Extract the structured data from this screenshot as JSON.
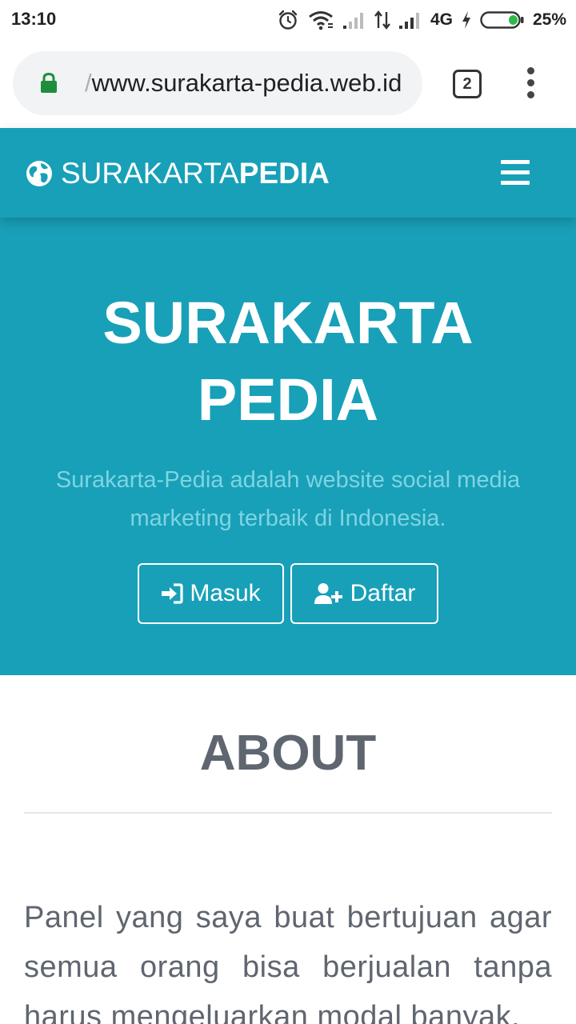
{
  "status_bar": {
    "time": "13:10",
    "network": "4G",
    "battery": "25%",
    "icons": [
      "alarm-icon",
      "wifi-icon",
      "signal-icon",
      "data-transfer-icon",
      "signal-icon",
      "charging-icon",
      "battery-icon"
    ]
  },
  "browser": {
    "url_prefix": "/",
    "url": "www.surakarta-pedia.web.id",
    "tab_count": "2",
    "icons": [
      "lock-icon",
      "tabs-icon",
      "more-vert-icon"
    ]
  },
  "navbar": {
    "brand_light": "SURAKARTA",
    "brand_bold": "PEDIA",
    "icons": [
      "globe-icon",
      "hamburger-menu-icon"
    ]
  },
  "hero": {
    "title_line1": "SURAKARTA",
    "title_line2": "PEDIA",
    "description": "Surakarta-Pedia adalah website social media marketing terbaik di Indonesia.",
    "login_label": "Masuk",
    "register_label": "Daftar",
    "icons": [
      "sign-in-icon",
      "user-plus-icon"
    ]
  },
  "about": {
    "title": "ABOUT",
    "text": "Panel yang saya buat bertujuan agar semua orang bisa berjualan tanpa harus mengeluarkan modal banyak."
  },
  "colors": {
    "primary": "#18a0b8",
    "hero_desc": "#7ed4e2",
    "text_gray": "#5f6670",
    "lock_green": "#1e8e3e",
    "battery_green": "#2fb84a"
  }
}
